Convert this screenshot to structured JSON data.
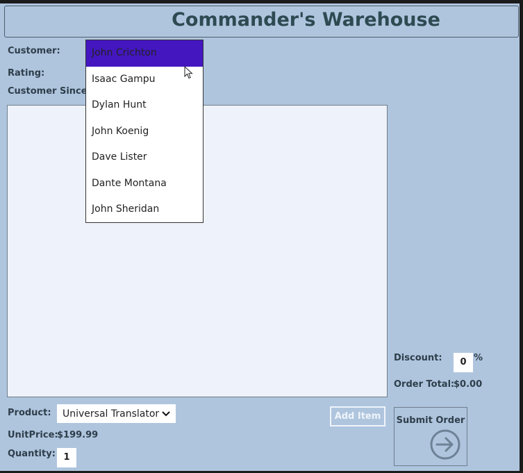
{
  "app": {
    "title": "Commander's Warehouse"
  },
  "customer_section": {
    "customer_label": "Customer:",
    "rating_label": "Rating:",
    "customer_since_label": "Customer Since:"
  },
  "customer_dropdown": {
    "options": [
      "John Crichton",
      "Isaac Gampu",
      "Dylan Hunt",
      "John Koenig",
      "Dave Lister",
      "Dante Montana",
      "John Sheridan"
    ],
    "highlighted_index": 0
  },
  "order_summary": {
    "discount_label": "Discount:",
    "discount_value": "0",
    "percent_sign": "%",
    "order_total_label": "Order Total:",
    "order_total_value": "$0.00"
  },
  "product_section": {
    "product_label": "Product:",
    "product_selected": "Universal Translator",
    "unit_price_label": "UnitPrice:",
    "unit_price_value": "$199.99",
    "quantity_label": "Quantity:",
    "quantity_value": "1"
  },
  "buttons": {
    "add_item": "Add Item",
    "submit_order": "Submit Order"
  },
  "colors": {
    "background": "#afc5de",
    "dropdown_highlight": "#4416c0"
  }
}
